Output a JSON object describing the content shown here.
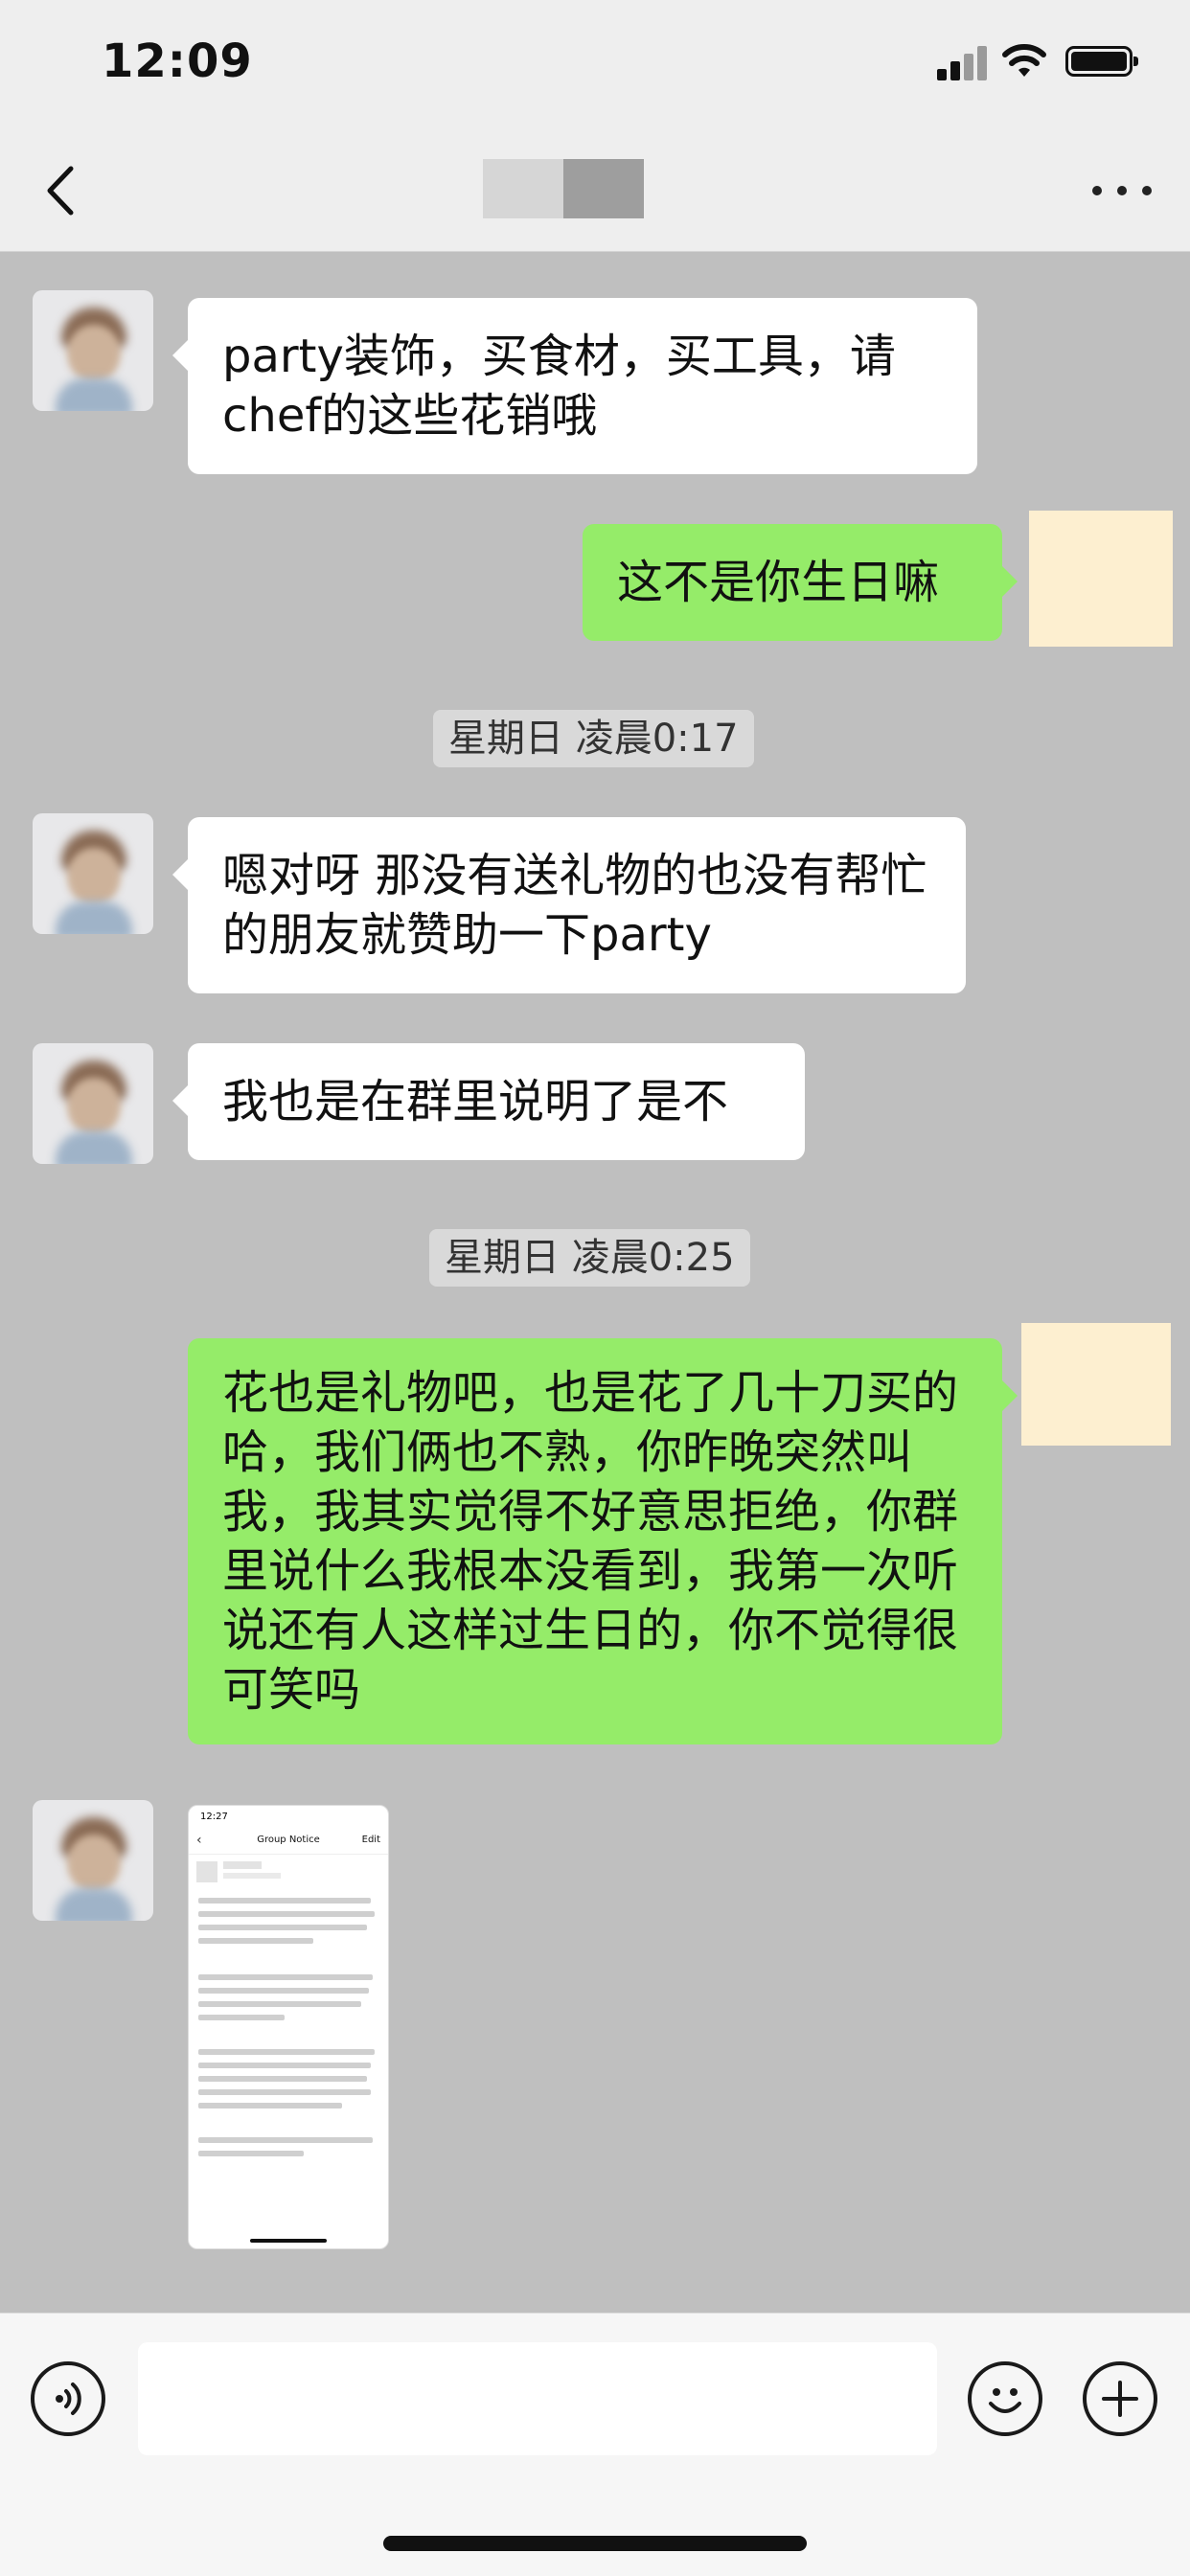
{
  "status_bar": {
    "time": "12:09"
  },
  "header": {
    "back_icon": "chevron-left-icon",
    "more_icon": "ellipsis-icon"
  },
  "messages": [
    {
      "from": "contact",
      "type": "text",
      "text": "party装饰，买食材，买工具，请chef的这些花销哦"
    },
    {
      "from": "me",
      "type": "text",
      "text": "这不是你生日嘛"
    },
    {
      "type": "timestamp",
      "text": "星期日 凌晨0:17"
    },
    {
      "from": "contact",
      "type": "text",
      "text": "嗯对呀 那没有送礼物的也没有帮忙的朋友就赞助一下party"
    },
    {
      "from": "contact",
      "type": "text",
      "text": "我也是在群里说明了是不"
    },
    {
      "type": "timestamp",
      "text": "星期日 凌晨0:25"
    },
    {
      "from": "me",
      "type": "text",
      "text": "花也是礼物吧，也是花了几十刀买的哈，我们俩也不熟，你昨晚突然叫我，我其实觉得不好意思拒绝，你群里说什么我根本没看到，我第一次听说还有人这样过生日的，你不觉得很可笑吗"
    },
    {
      "from": "contact",
      "type": "image",
      "image": {
        "time": "12:27",
        "title": "Group Notice",
        "edit": "Edit"
      }
    }
  ],
  "input_bar": {
    "voice_icon": "voice-icon",
    "emoji_icon": "emoji-icon",
    "plus_icon": "plus-icon",
    "input_value": ""
  },
  "colors": {
    "chat_bg": "#bfbfbf",
    "incoming_bubble": "#ffffff",
    "outgoing_bubble": "#95ec69",
    "timestamp_chip": "#d9d9d9"
  }
}
